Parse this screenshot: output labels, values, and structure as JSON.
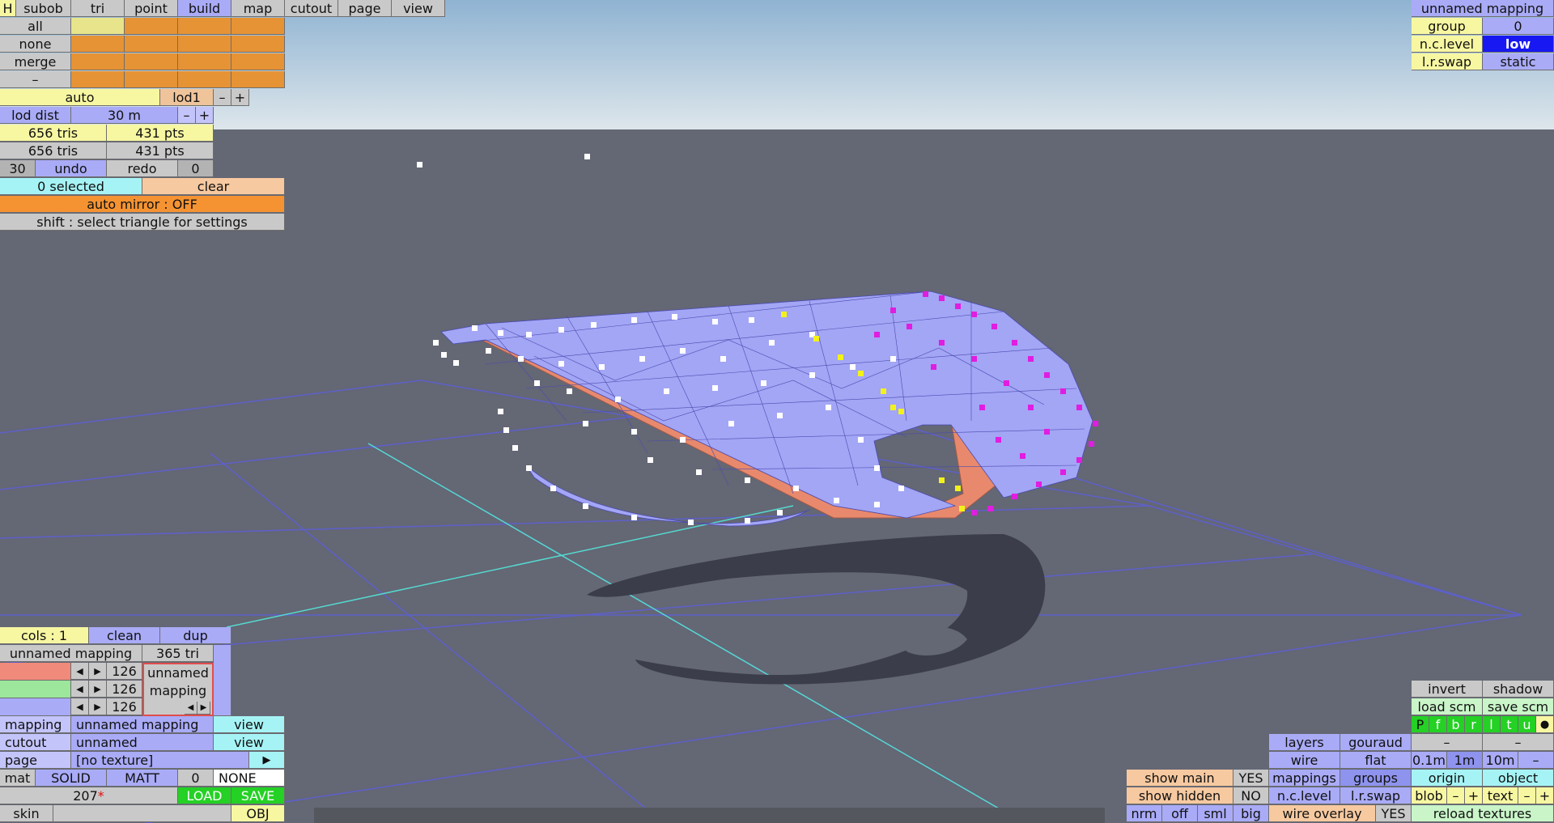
{
  "menu": [
    "H",
    "subob",
    "tri",
    "point",
    "build",
    "map",
    "cutout",
    "page",
    "view"
  ],
  "subob_panel": {
    "rows": [
      "all",
      "none",
      "merge",
      "–"
    ]
  },
  "lod": {
    "auto_label": "auto",
    "lod_label": "lod1",
    "minus": "–",
    "plus": "+",
    "dist_label": "lod dist",
    "dist_value": "30 m",
    "tris_1": "656 tris",
    "pts_1": "431 pts",
    "tris_2": "656 tris",
    "pts_2": "431 pts"
  },
  "history": {
    "undo_count": "30",
    "undo": "undo",
    "redo": "redo",
    "redo_count": "0"
  },
  "selection": {
    "selected": "0 selected",
    "clear": "clear",
    "auto_mirror": "auto mirror : OFF",
    "hint": "shift : select triangle for settings"
  },
  "mapping_top": {
    "title": "unnamed mapping",
    "group_label": "group",
    "group_value": "0",
    "nclevel_label": "n.c.level",
    "nclevel_value": "low",
    "lrswap_label": "l.r.swap",
    "lrswap_value": "static"
  },
  "bottom_left": {
    "cols": "cols : 1",
    "clean": "clean",
    "dup": "dup",
    "mapping_name": "unnamed mapping",
    "tri_count": "365 tri",
    "rgb": [
      "126",
      "126",
      "126"
    ],
    "preview_line1": "unnamed",
    "preview_line2": "mapping",
    "arrow_left": "◀",
    "arrow_right": "▶",
    "mapping_label": "mapping",
    "mapping_value": "unnamed mapping",
    "view": "view",
    "cutout_label": "cutout",
    "cutout_value": "unnamed",
    "page_label": "page",
    "page_value": "[no texture]",
    "play": "▶",
    "mat": "mat",
    "solid": "SOLID",
    "matt": "MATT",
    "mat_num": "0",
    "none": "NONE",
    "mat_id": "207",
    "mat_star": "*",
    "load": "LOAD",
    "save": "SAVE",
    "skin": "skin",
    "obj": "OBJ"
  },
  "bottom_right": {
    "invert": "invert",
    "shadow": "shadow",
    "load_scm": "load scm",
    "save_scm": "save scm",
    "toggles": [
      "P",
      "f",
      "b",
      "r",
      "l",
      "t",
      "u",
      "●"
    ],
    "layers": "layers",
    "gouraud": "gouraud",
    "dash": "–",
    "wire": "wire",
    "flat": "flat",
    "grid_steps": [
      "0.1m",
      "1m",
      "10m"
    ],
    "mappings": "mappings",
    "groups": "groups",
    "origin": "origin",
    "object": "object",
    "nclevel": "n.c.level",
    "lrswap": "l.r.swap",
    "blob": "blob",
    "minus": "–",
    "plus": "+",
    "text": "text",
    "show_main": "show main",
    "show_main_val": "YES",
    "show_hidden": "show hidden",
    "show_hidden_val": "NO",
    "nrm": "nrm",
    "off": "off",
    "sml": "sml",
    "big": "big",
    "wire_overlay": "wire overlay",
    "wire_overlay_val": "YES",
    "reload_textures": "reload textures"
  },
  "colors": {
    "sky_top": "#93b6d3",
    "sky_bottom": "#d7e3ea",
    "floor": "#646774",
    "grid": "#5d60c9",
    "axis": "#55d9d0",
    "mesh_fill": "#a3a5f5",
    "mesh_edge": "#e8896d",
    "vertex_white": "#ffffff",
    "vertex_magenta": "#e01de0",
    "vertex_yellow": "#f2f21a"
  }
}
